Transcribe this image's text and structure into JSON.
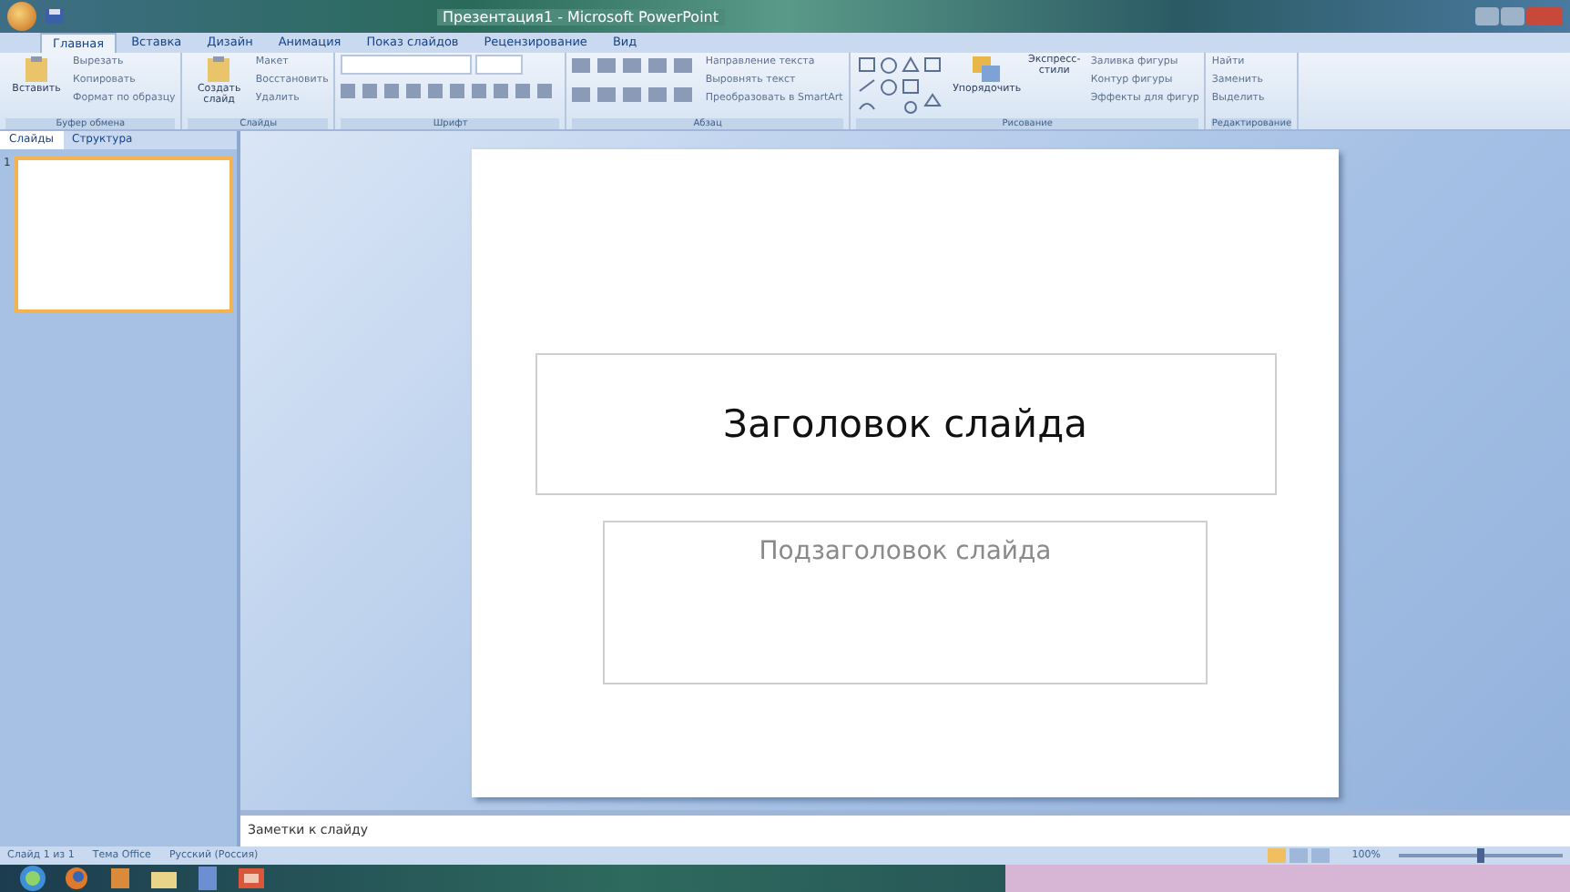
{
  "window": {
    "title": "Презентация1 - Microsoft PowerPoint"
  },
  "ribbon_tabs": [
    {
      "label": "Главная",
      "selected": true
    },
    {
      "label": "Вставка",
      "selected": false
    },
    {
      "label": "Дизайн",
      "selected": false
    },
    {
      "label": "Анимация",
      "selected": false
    },
    {
      "label": "Показ слайдов",
      "selected": false
    },
    {
      "label": "Рецензирование",
      "selected": false
    },
    {
      "label": "Вид",
      "selected": false
    }
  ],
  "groups": [
    {
      "name": "Буфер обмена",
      "big": "Вставить",
      "small": [
        "Вырезать",
        "Копировать",
        "Формат по образцу"
      ]
    },
    {
      "name": "Слайды",
      "big": "Создать слайд",
      "small": [
        "Макет",
        "Восстановить",
        "Удалить"
      ]
    },
    {
      "name": "Шрифт",
      "kind": "font"
    },
    {
      "name": "Абзац",
      "kind": "para",
      "small": [
        "Направление текста",
        "Выровнять текст",
        "Преобразовать в SmartArt"
      ]
    },
    {
      "name": "Рисование",
      "kind": "draw",
      "big": "Упорядочить",
      "big2": "Экспресс-стили",
      "small": [
        "Заливка фигуры",
        "Контур фигуры",
        "Эффекты для фигур"
      ]
    },
    {
      "name": "Редактирование",
      "small": [
        "Найти",
        "Заменить",
        "Выделить"
      ]
    }
  ],
  "panel_tabs": [
    {
      "label": "Слайды",
      "selected": true
    },
    {
      "label": "Структура",
      "selected": false
    }
  ],
  "thumbnails": [
    {
      "number": "1",
      "selected": true
    }
  ],
  "slide": {
    "title": "Заголовок слайда",
    "subtitle": "Подзаголовок слайда"
  },
  "notes": {
    "placeholder": "Заметки к слайду"
  },
  "status_bar": [
    "Слайд 1 из 1",
    "Тема Office",
    "Русский (Россия)"
  ],
  "zoom": "100%",
  "zoom_slider": {
    "level": 0.5
  }
}
